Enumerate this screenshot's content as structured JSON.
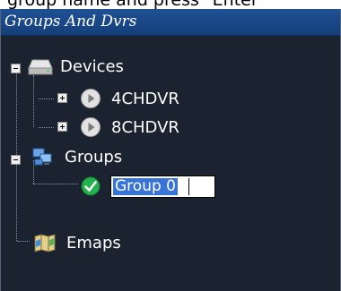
{
  "top_strip": {
    "text": "group name and press \"Enter\""
  },
  "panel": {
    "title": "Groups And Dvrs"
  },
  "tree": {
    "devices": {
      "label": "Devices",
      "children": [
        {
          "label": "4CHDVR"
        },
        {
          "label": "8CHDVR"
        }
      ]
    },
    "groups": {
      "label": "Groups",
      "children": [
        {
          "edit_value": "Group 0"
        }
      ]
    },
    "emaps": {
      "label": "Emaps"
    }
  },
  "icons": {
    "devices": "hard-drive-icon",
    "dvr": "play-disc-icon",
    "groups": "network-computers-icon",
    "group_item": "green-check-icon",
    "emaps": "map-icon"
  }
}
